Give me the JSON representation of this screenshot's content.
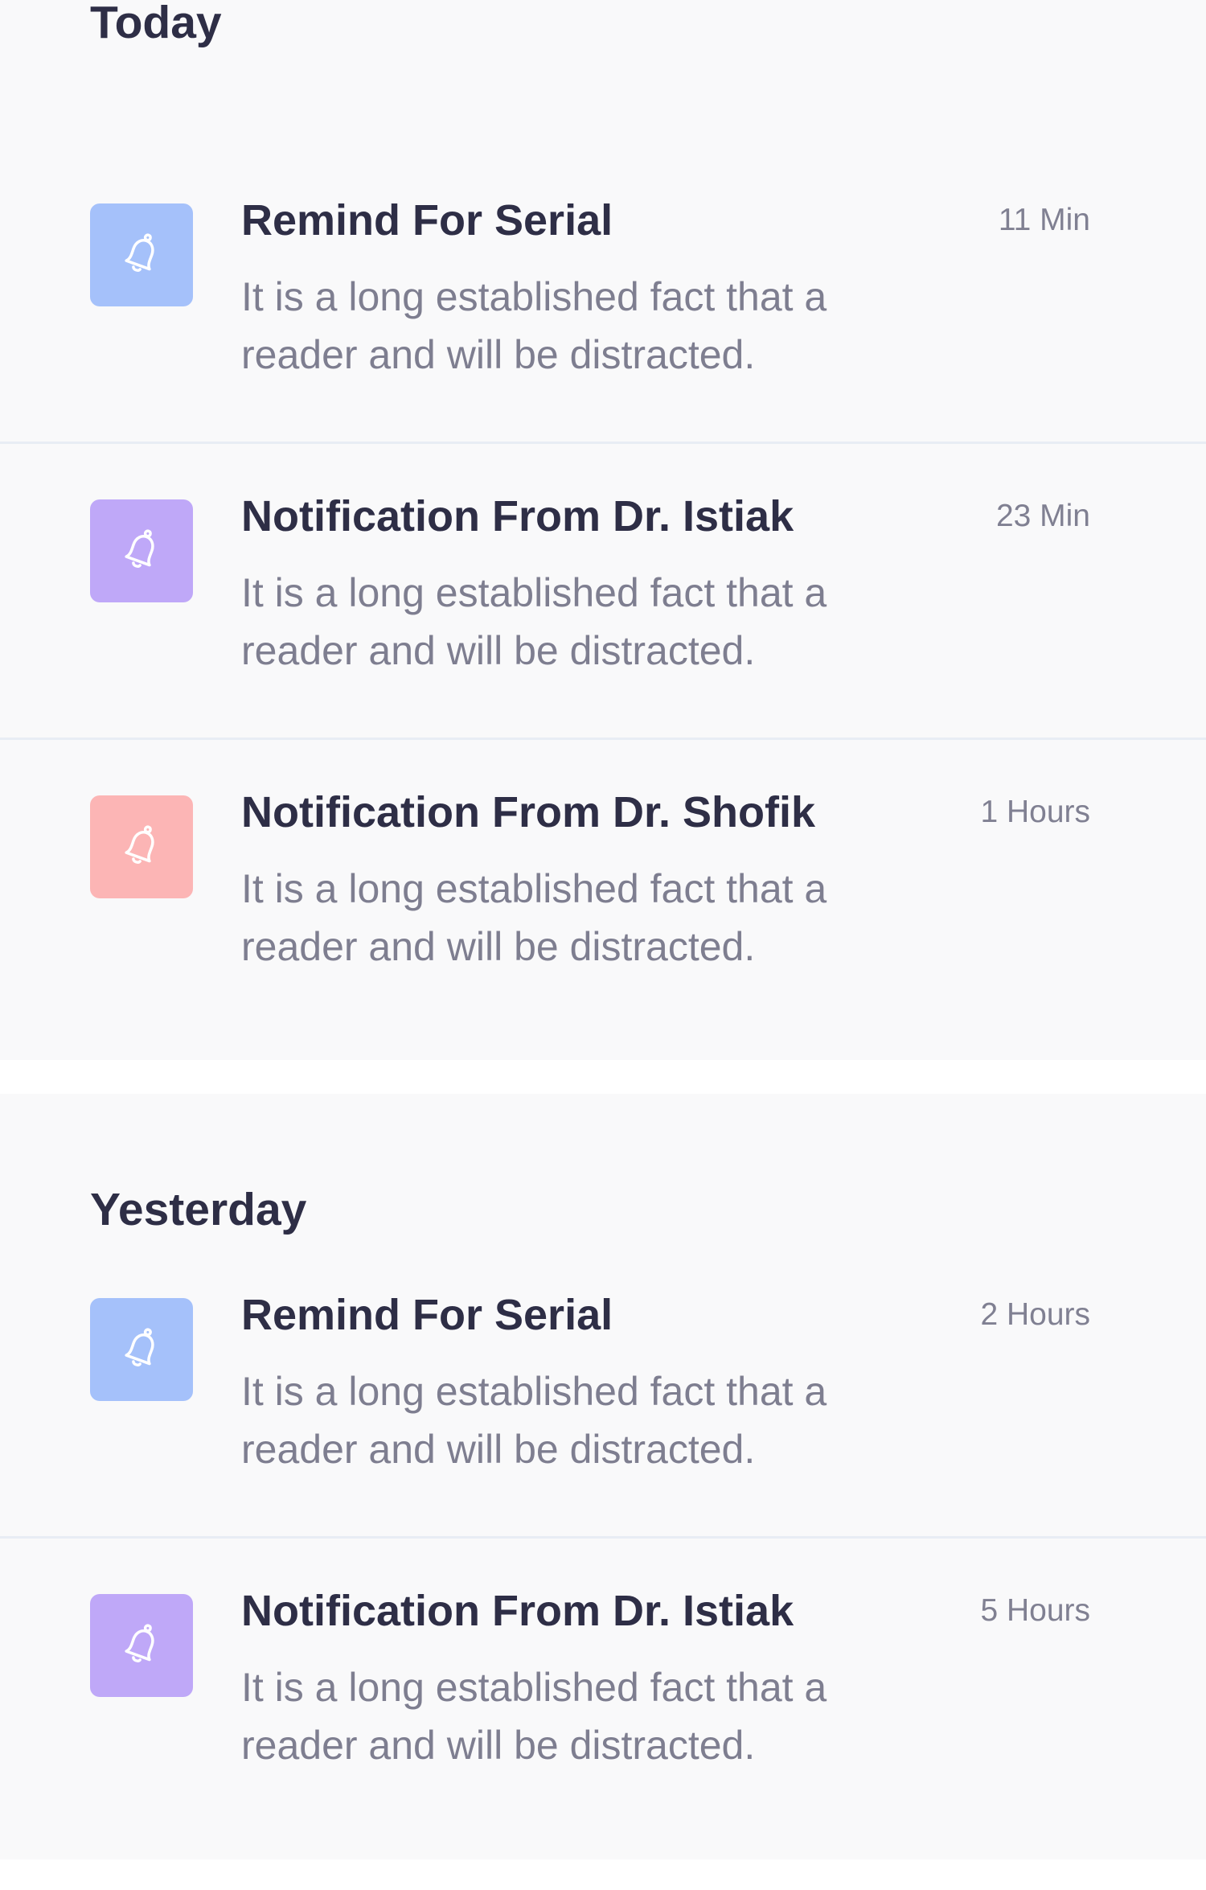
{
  "colors": {
    "background": "#f9f9fa",
    "title_text": "#2e2e46",
    "body_text": "#7e7e90",
    "divider": "#e8edf4",
    "icon_blue": "#a5c1fa",
    "icon_purple": "#bfa8f8",
    "icon_pink": "#fcb5b5"
  },
  "sections": [
    {
      "title": "Today",
      "items": [
        {
          "icon": "bell-icon",
          "icon_color": "#a5c1fa",
          "title": "Remind For Serial",
          "body": "It is a long established fact that a reader and will be distracted.",
          "time": "11 Min"
        },
        {
          "icon": "bell-icon",
          "icon_color": "#bfa8f8",
          "title": "Notification From Dr. Istiak",
          "body": "It is a long established fact that a reader and will be distracted.",
          "time": "23 Min"
        },
        {
          "icon": "bell-icon",
          "icon_color": "#fcb5b5",
          "title": "Notification From Dr. Shofik",
          "body": "It is a long established fact that a reader and will be distracted.",
          "time": "1 Hours"
        }
      ]
    },
    {
      "title": "Yesterday",
      "items": [
        {
          "icon": "bell-icon",
          "icon_color": "#a5c1fa",
          "title": "Remind For Serial",
          "body": "It is a long established fact that a reader and will be distracted.",
          "time": "2 Hours"
        },
        {
          "icon": "bell-icon",
          "icon_color": "#bfa8f8",
          "title": "Notification From Dr. Istiak",
          "body": "It is a long established fact that a reader and will be distracted.",
          "time": "5 Hours"
        }
      ]
    }
  ]
}
